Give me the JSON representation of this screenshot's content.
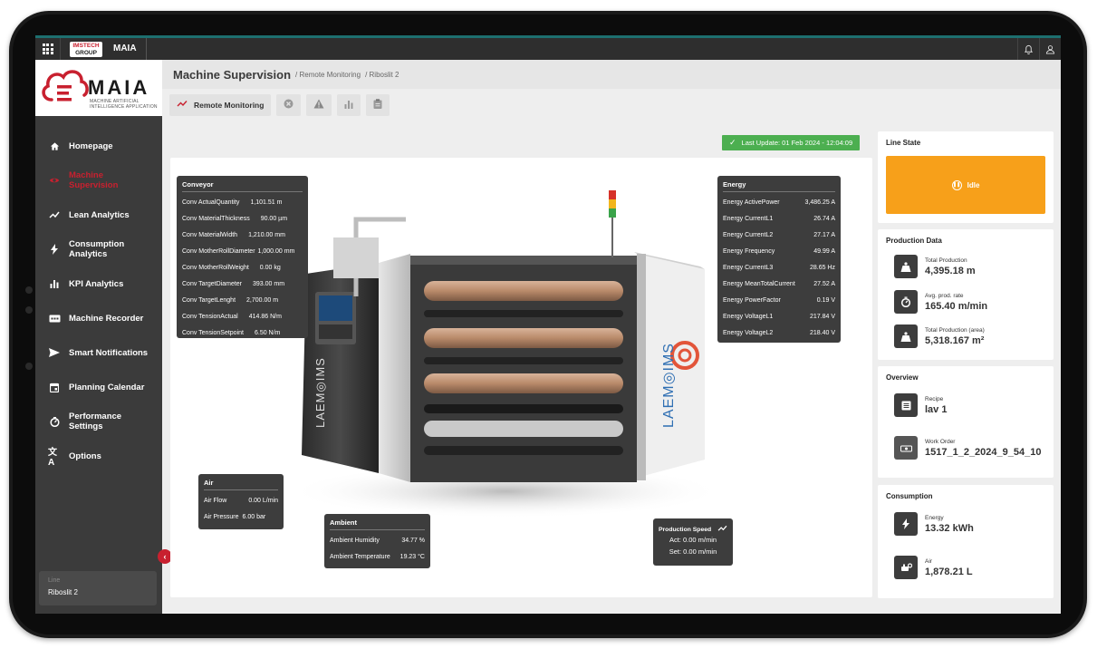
{
  "topbar": {
    "app_name": "MAIA",
    "brand_top": "IMSTECH",
    "brand_bottom": "GROUP"
  },
  "logo": {
    "word": "MAIA",
    "sub1": "MACHINE ARTIFICIAL",
    "sub2": "INTELLIGENCE APPLICATION"
  },
  "sidebar": {
    "items": [
      {
        "label": "Homepage",
        "icon": "home-icon"
      },
      {
        "label": "Machine Supervision",
        "icon": "eye-icon"
      },
      {
        "label": "Lean Analytics",
        "icon": "trend-icon"
      },
      {
        "label": "Consumption Analytics",
        "icon": "bolt-icon"
      },
      {
        "label": "KPI Analytics",
        "icon": "bar-chart-icon"
      },
      {
        "label": "Machine Recorder",
        "icon": "recorder-icon"
      },
      {
        "label": "Smart Notifications",
        "icon": "send-icon"
      },
      {
        "label": "Planning Calendar",
        "icon": "calendar-icon"
      },
      {
        "label": "Performance Settings",
        "icon": "gauge-icon"
      },
      {
        "label": "Options",
        "icon": "translate-icon"
      }
    ],
    "line_title": "Line",
    "line_value": "Riboslit 2"
  },
  "header": {
    "title": "Machine Supervision",
    "crumb1": "/ Remote Monitoring",
    "crumb2": "/ Riboslit 2"
  },
  "tabs": {
    "active_label": "Remote Monitoring"
  },
  "last_update": "Last Update: 01 Feb 2024 - 12:04:09",
  "conveyor": {
    "title": "Conveyor",
    "rows": [
      {
        "k": "Conv ActualQuantity",
        "v": "1,101.51 m"
      },
      {
        "k": "Conv MaterialThickness",
        "v": "90.00 µm"
      },
      {
        "k": "Conv MaterialWidth",
        "v": "1,210.00 mm"
      },
      {
        "k": "Conv MotherRollDiameter",
        "v": "1,000.00 mm"
      },
      {
        "k": "Conv MotherRollWeight",
        "v": "0.00 kg"
      },
      {
        "k": "Conv TargetDiameter",
        "v": "393.00 mm"
      },
      {
        "k": "Conv TargetLenght",
        "v": "2,700.00 m"
      },
      {
        "k": "Conv TensionActual",
        "v": "414.86 N/m"
      },
      {
        "k": "Conv TensionSetpoint",
        "v": "6.50 N/m"
      }
    ]
  },
  "energy": {
    "title": "Energy",
    "rows": [
      {
        "k": "Energy ActivePower",
        "v": "3,486.25 A"
      },
      {
        "k": "Energy CurrentL1",
        "v": "26.74 A"
      },
      {
        "k": "Energy CurrentL2",
        "v": "27.17 A"
      },
      {
        "k": "Energy Frequency",
        "v": "49.99 A"
      },
      {
        "k": "Energy CurrentL3",
        "v": "28.65 Hz"
      },
      {
        "k": "Energy MeanTotalCurrent",
        "v": "27.52 A"
      },
      {
        "k": "Energy PowerFactor",
        "v": "0.19 V"
      },
      {
        "k": "Energy VoltageL1",
        "v": "217.84 V"
      },
      {
        "k": "Energy VoltageL2",
        "v": "218.40 V"
      }
    ]
  },
  "air": {
    "title": "Air",
    "rows": [
      {
        "k": "Air Flow",
        "v": "0.00 L/min"
      },
      {
        "k": "Air Pressure",
        "v": "6.00 bar"
      }
    ]
  },
  "ambient": {
    "title": "Ambient",
    "rows": [
      {
        "k": "Ambient Humidity",
        "v": "34.77 %"
      },
      {
        "k": "Ambient Temperature",
        "v": "19.23 °C"
      }
    ]
  },
  "speed": {
    "title": "Production Speed",
    "act": "Act: 0.00 m/min",
    "set": "Set: 0.00 m/min"
  },
  "machine_brand": "LAEM◎IMS",
  "line_state": {
    "title": "Line State",
    "state": "Idle",
    "color": "#f7a01a"
  },
  "production": {
    "title": "Production Data",
    "total_label": "Total Production",
    "total_value": "4,395.18 m",
    "rate_label": "Avg. prod. rate",
    "rate_value": "165.40 m/min",
    "area_label": "Total Production (area)",
    "area_value": "5,318.167 m²"
  },
  "overview": {
    "title": "Overview",
    "recipe_label": "Recipe",
    "recipe_value": "lav 1",
    "wo_label": "Work Order",
    "wo_value": "1517_1_2_2024_9_54_10"
  },
  "consumption": {
    "title": "Consumption",
    "energy_label": "Energy",
    "energy_value": "13.32 kWh",
    "air_label": "Air",
    "air_value": "1,878.21 L"
  },
  "colors": {
    "accent": "#c8202f",
    "sidebar": "#3b3b3b",
    "update": "#4caf50"
  }
}
